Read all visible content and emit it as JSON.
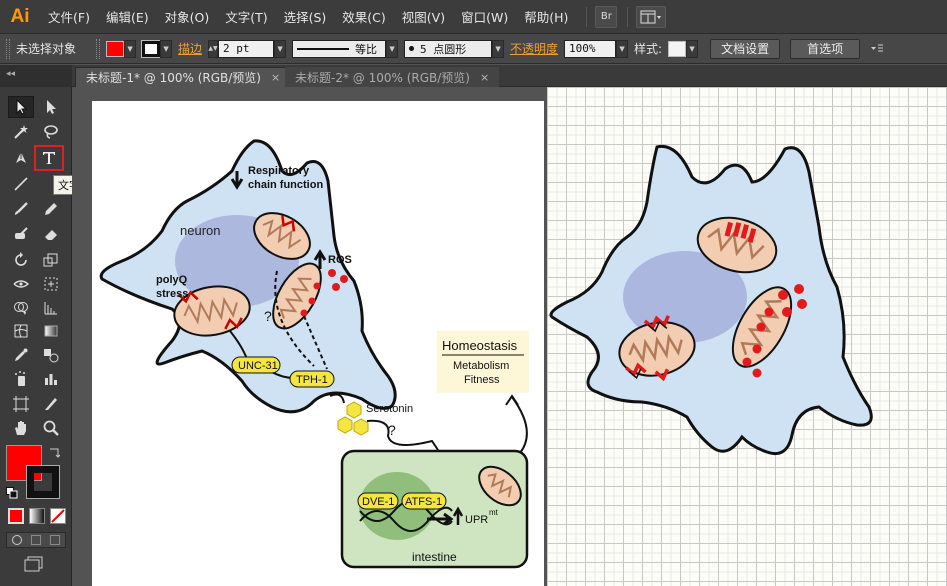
{
  "app": {
    "logo": "Ai"
  },
  "menu": [
    "文件(F)",
    "编辑(E)",
    "对象(O)",
    "文字(T)",
    "选择(S)",
    "效果(C)",
    "视图(V)",
    "窗口(W)",
    "帮助(H)"
  ],
  "menu_buttons": {
    "bridge": "Br"
  },
  "control_bar": {
    "selection_status": "未选择对象",
    "stroke_label": "描边",
    "stroke_weight": "2 pt",
    "stroke_profile": "等比",
    "brush": "5 点圆形",
    "opacity_label": "不透明度",
    "opacity_value": "100%",
    "style_label": "样式:",
    "document_setup": "文档设置",
    "preferences": "首选项"
  },
  "tabs": [
    {
      "label": "未标题-1* @ 100% (RGB/预览)",
      "close": "×"
    },
    {
      "label": "未标题-2* @ 100% (RGB/预览)",
      "close": "×"
    }
  ],
  "toolbox": {
    "collapse": "◂◂",
    "tooltip": "文字工具 (T)"
  },
  "colors": {
    "fill": "#ff0000",
    "accent": "#e02020",
    "cell_fill": "#cfe2f3",
    "mito": "#f2cdb1"
  },
  "figure": {
    "respiratory": [
      "Respiratory",
      "chain function"
    ],
    "neuron": "neuron",
    "ros": "ROS",
    "polyq": [
      "polyQ",
      "stress"
    ],
    "question": "?",
    "unc31": "UNC-31",
    "tph1": "TPH-1",
    "serotonin": "Serotonin",
    "homeostasis": "Homeostasis",
    "metabolism": "Metabolism",
    "fitness": "Fitness",
    "dve1": "DVE-1",
    "atfs1": "ATFS-1",
    "upr": "UPR",
    "upr_sup": "mt",
    "intestine": "intestine"
  }
}
